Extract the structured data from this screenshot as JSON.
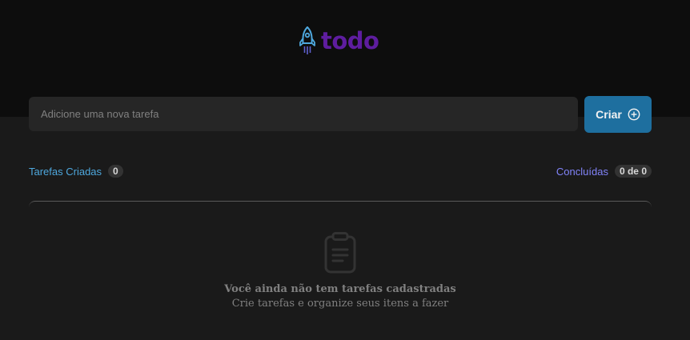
{
  "header": {
    "logo_text": "todo",
    "logo_icon": "rocket-icon",
    "logo_color": "#5e1d9f"
  },
  "new_task": {
    "placeholder": "Adicione uma nova tarefa",
    "value": ""
  },
  "create_button": {
    "label": "Criar",
    "icon": "plus-circle-icon",
    "color": "#1e6f9f"
  },
  "counters": {
    "created_label": "Tarefas Criadas",
    "created_count": "0",
    "done_label": "Concluídas",
    "done_count": "0 de 0"
  },
  "empty_state": {
    "icon": "clipboard-icon",
    "title": "Você ainda não tem tarefas cadastradas",
    "subtitle": "Crie tarefas e organize seus itens a fazer"
  },
  "colors": {
    "header_bg": "#0d0d0d",
    "page_bg": "#1a1a1a",
    "accent_blue": "#4ea8de",
    "accent_purple": "#8284fa"
  }
}
